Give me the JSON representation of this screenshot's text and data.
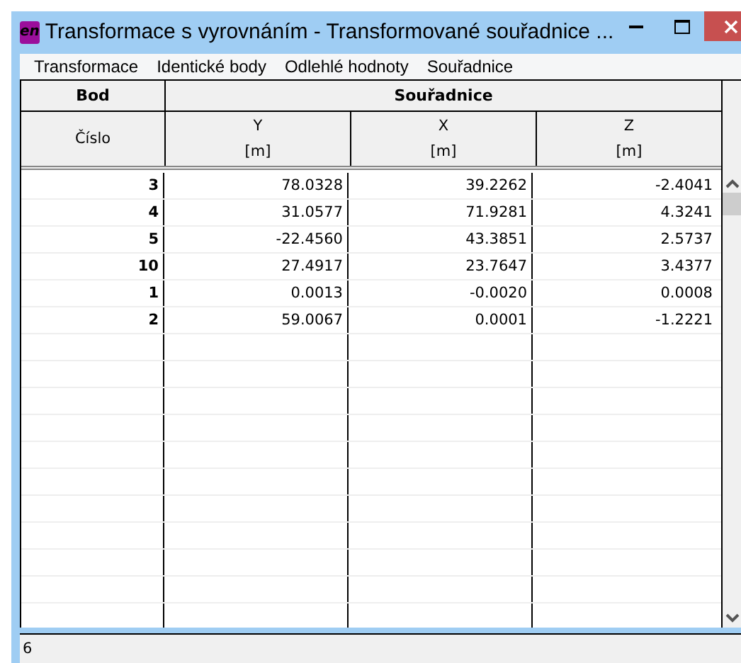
{
  "window": {
    "title": "Transformace s vyrovnáním - Transformované souřadnice ...",
    "icon_text": "en"
  },
  "menu": [
    "Transformace",
    "Identické body",
    "Odlehlé hodnoty",
    "Souřadnice"
  ],
  "table": {
    "group_headers": [
      "Bod",
      "Souřadnice"
    ],
    "columns": [
      {
        "name": "Číslo"
      },
      {
        "name": "Y",
        "unit": "[m]"
      },
      {
        "name": "X",
        "unit": "[m]"
      },
      {
        "name": "Z",
        "unit": "[m]"
      }
    ],
    "rows": [
      [
        "3",
        "78.0328",
        "39.2262",
        "-2.4041"
      ],
      [
        "4",
        "31.0577",
        "71.9281",
        "4.3241"
      ],
      [
        "5",
        "-22.4560",
        "43.3851",
        "2.5737"
      ],
      [
        "10",
        "27.4917",
        "23.7647",
        "3.4377"
      ],
      [
        "1",
        "0.0013",
        "-0.0020",
        "0.0008"
      ],
      [
        "2",
        "59.0067",
        "0.0001",
        "-1.2221"
      ]
    ]
  },
  "status_bar": "6"
}
